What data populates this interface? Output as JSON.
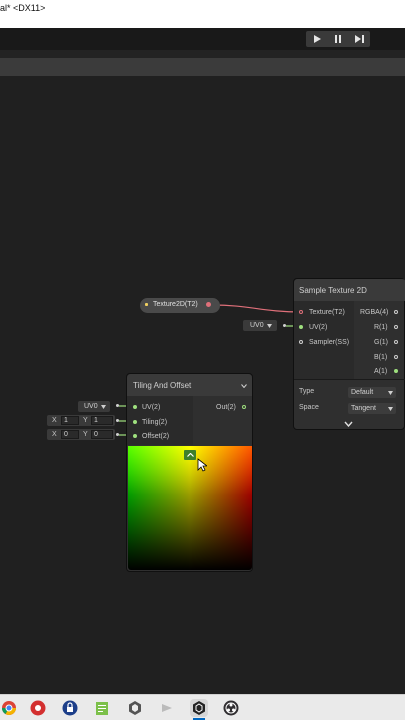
{
  "window": {
    "title": "al* <DX11>"
  },
  "play_controls": {
    "play": "play-icon",
    "pause": "pause-icon",
    "step": "step-icon"
  },
  "nodes": {
    "texture_property": {
      "label": "Texture2D(T2)"
    },
    "uv_input_sample": {
      "value": "UV0"
    },
    "sample_texture": {
      "title": "Sample Texture 2D",
      "inputs": [
        "Texture(T2)",
        "UV(2)",
        "Sampler(SS)"
      ],
      "outputs": [
        "RGBA(4)",
        "R(1)",
        "G(1)",
        "B(1)",
        "A(1)"
      ],
      "type_label": "Type",
      "type_value": "Default",
      "space_label": "Space",
      "space_value": "Tangent"
    },
    "tiling_offset": {
      "title": "Tiling And Offset",
      "inputs": [
        "UV(2)",
        "Tiling(2)",
        "Offset(2)"
      ],
      "output": "Out(2)",
      "uv_value": "UV0",
      "tiling": {
        "x_label": "X",
        "x": "1",
        "y_label": "Y",
        "y": "1"
      },
      "offset": {
        "x_label": "X",
        "x": "0",
        "y_label": "Y",
        "y": "0"
      }
    }
  },
  "colors": {
    "wire_texture": "#e0707a",
    "wire_vector": "#9ee07e",
    "accent": "#3d7f2b"
  },
  "taskbar": {
    "icons": [
      "chrome-icon",
      "recorder-icon",
      "vpn-icon",
      "notepad-icon",
      "unity-hub-icon",
      "media-icon",
      "unity-icon",
      "obs-icon"
    ]
  }
}
